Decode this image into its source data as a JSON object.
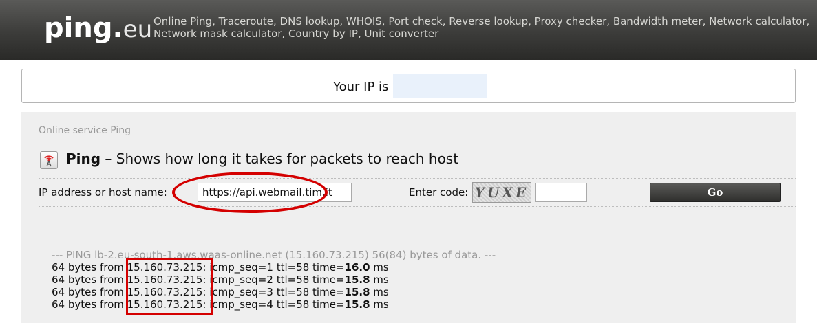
{
  "header": {
    "logo_main": "ping",
    "logo_dot": ".",
    "logo_tld": "eu",
    "tagline": "Online Ping, Traceroute, DNS lookup, WHOIS, Port check, Reverse lookup, Proxy checker, Bandwidth meter, Network calculator, Network mask calculator, Country by IP, Unit converter"
  },
  "ipbox": {
    "label": "Your IP is"
  },
  "panel": {
    "breadcrumb": "Online service Ping",
    "title_bold": "Ping",
    "title_rest": " – Shows how long it takes for packets to reach host",
    "host_label": "IP address or host name:",
    "host_value": "https://api.webmail.tim.it",
    "code_label": "Enter code:",
    "captcha_text": "YUXE",
    "go_label": "Go"
  },
  "output": {
    "header": "--- PING lb-2.eu-south-1.aws.waas-online.net (15.160.73.215) 56(84) bytes of data. ---",
    "lines": [
      {
        "prefix": "64 bytes from ",
        "ip": "15.160.73.215",
        "mid": ": icmp_seq=1 ttl=58 time=",
        "time": "16.0",
        "unit": " ms"
      },
      {
        "prefix": "64 bytes from ",
        "ip": "15.160.73.215",
        "mid": ": icmp_seq=2 ttl=58 time=",
        "time": "15.8",
        "unit": " ms"
      },
      {
        "prefix": "64 bytes from ",
        "ip": "15.160.73.215",
        "mid": ": icmp_seq=3 ttl=58 time=",
        "time": "15.8",
        "unit": " ms"
      },
      {
        "prefix": "64 bytes from ",
        "ip": "15.160.73.215",
        "mid": ": icmp_seq=4 ttl=58 time=",
        "time": "15.8",
        "unit": " ms"
      }
    ]
  },
  "colors": {
    "annotation": "#d40000",
    "header_bg": "#3c3c3a",
    "panel_bg": "#efefef"
  },
  "icons": {
    "ping": "antenna-signal-icon"
  }
}
